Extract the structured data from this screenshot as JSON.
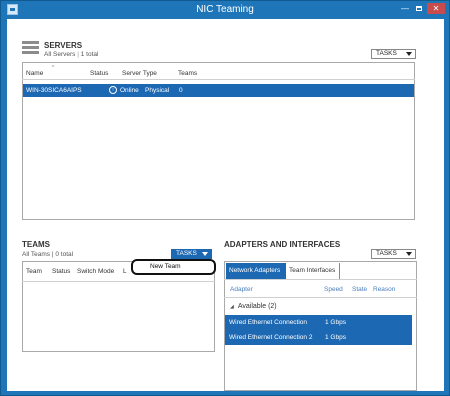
{
  "window": {
    "title": "NIC Teaming",
    "controls": {
      "minimize": "—",
      "close": "✕"
    }
  },
  "servers": {
    "title": "SERVERS",
    "subtitle_scope": "All Servers",
    "subtitle_sep": "|",
    "subtitle_count": "1 total",
    "tasks_label": "TASKS",
    "columns": [
      "Name",
      "Status",
      "Server Type",
      "Teams"
    ],
    "rows": [
      {
        "name": "WIN-30SICA6AIPS",
        "status": "Online",
        "server_type": "Physical",
        "teams": "0"
      }
    ]
  },
  "teams": {
    "title": "TEAMS",
    "subtitle": "All Teams | 0 total",
    "tasks_label": "TASKS",
    "columns": [
      "Team",
      "Status",
      "Switch Mode",
      "L"
    ],
    "menu": {
      "new_team": "New Team"
    }
  },
  "adapters": {
    "title": "ADAPTERS AND INTERFACES",
    "tasks_label": "TASKS",
    "tabs": [
      "Network Adapters",
      "Team Interfaces"
    ],
    "columns": [
      "Adapter",
      "Speed",
      "State",
      "Reason"
    ],
    "group": {
      "label": "Available (2)",
      "arrow": "◢"
    },
    "rows": [
      {
        "adapter": "Wired Ethernet Connection",
        "speed": "1 Gbps"
      },
      {
        "adapter": "Wired Ethernet Connection 2",
        "speed": "1 Gbps"
      }
    ]
  },
  "colors": {
    "window_frame": "#1e76b8",
    "selection": "#1d68b3",
    "close_button": "#c94c4c"
  }
}
